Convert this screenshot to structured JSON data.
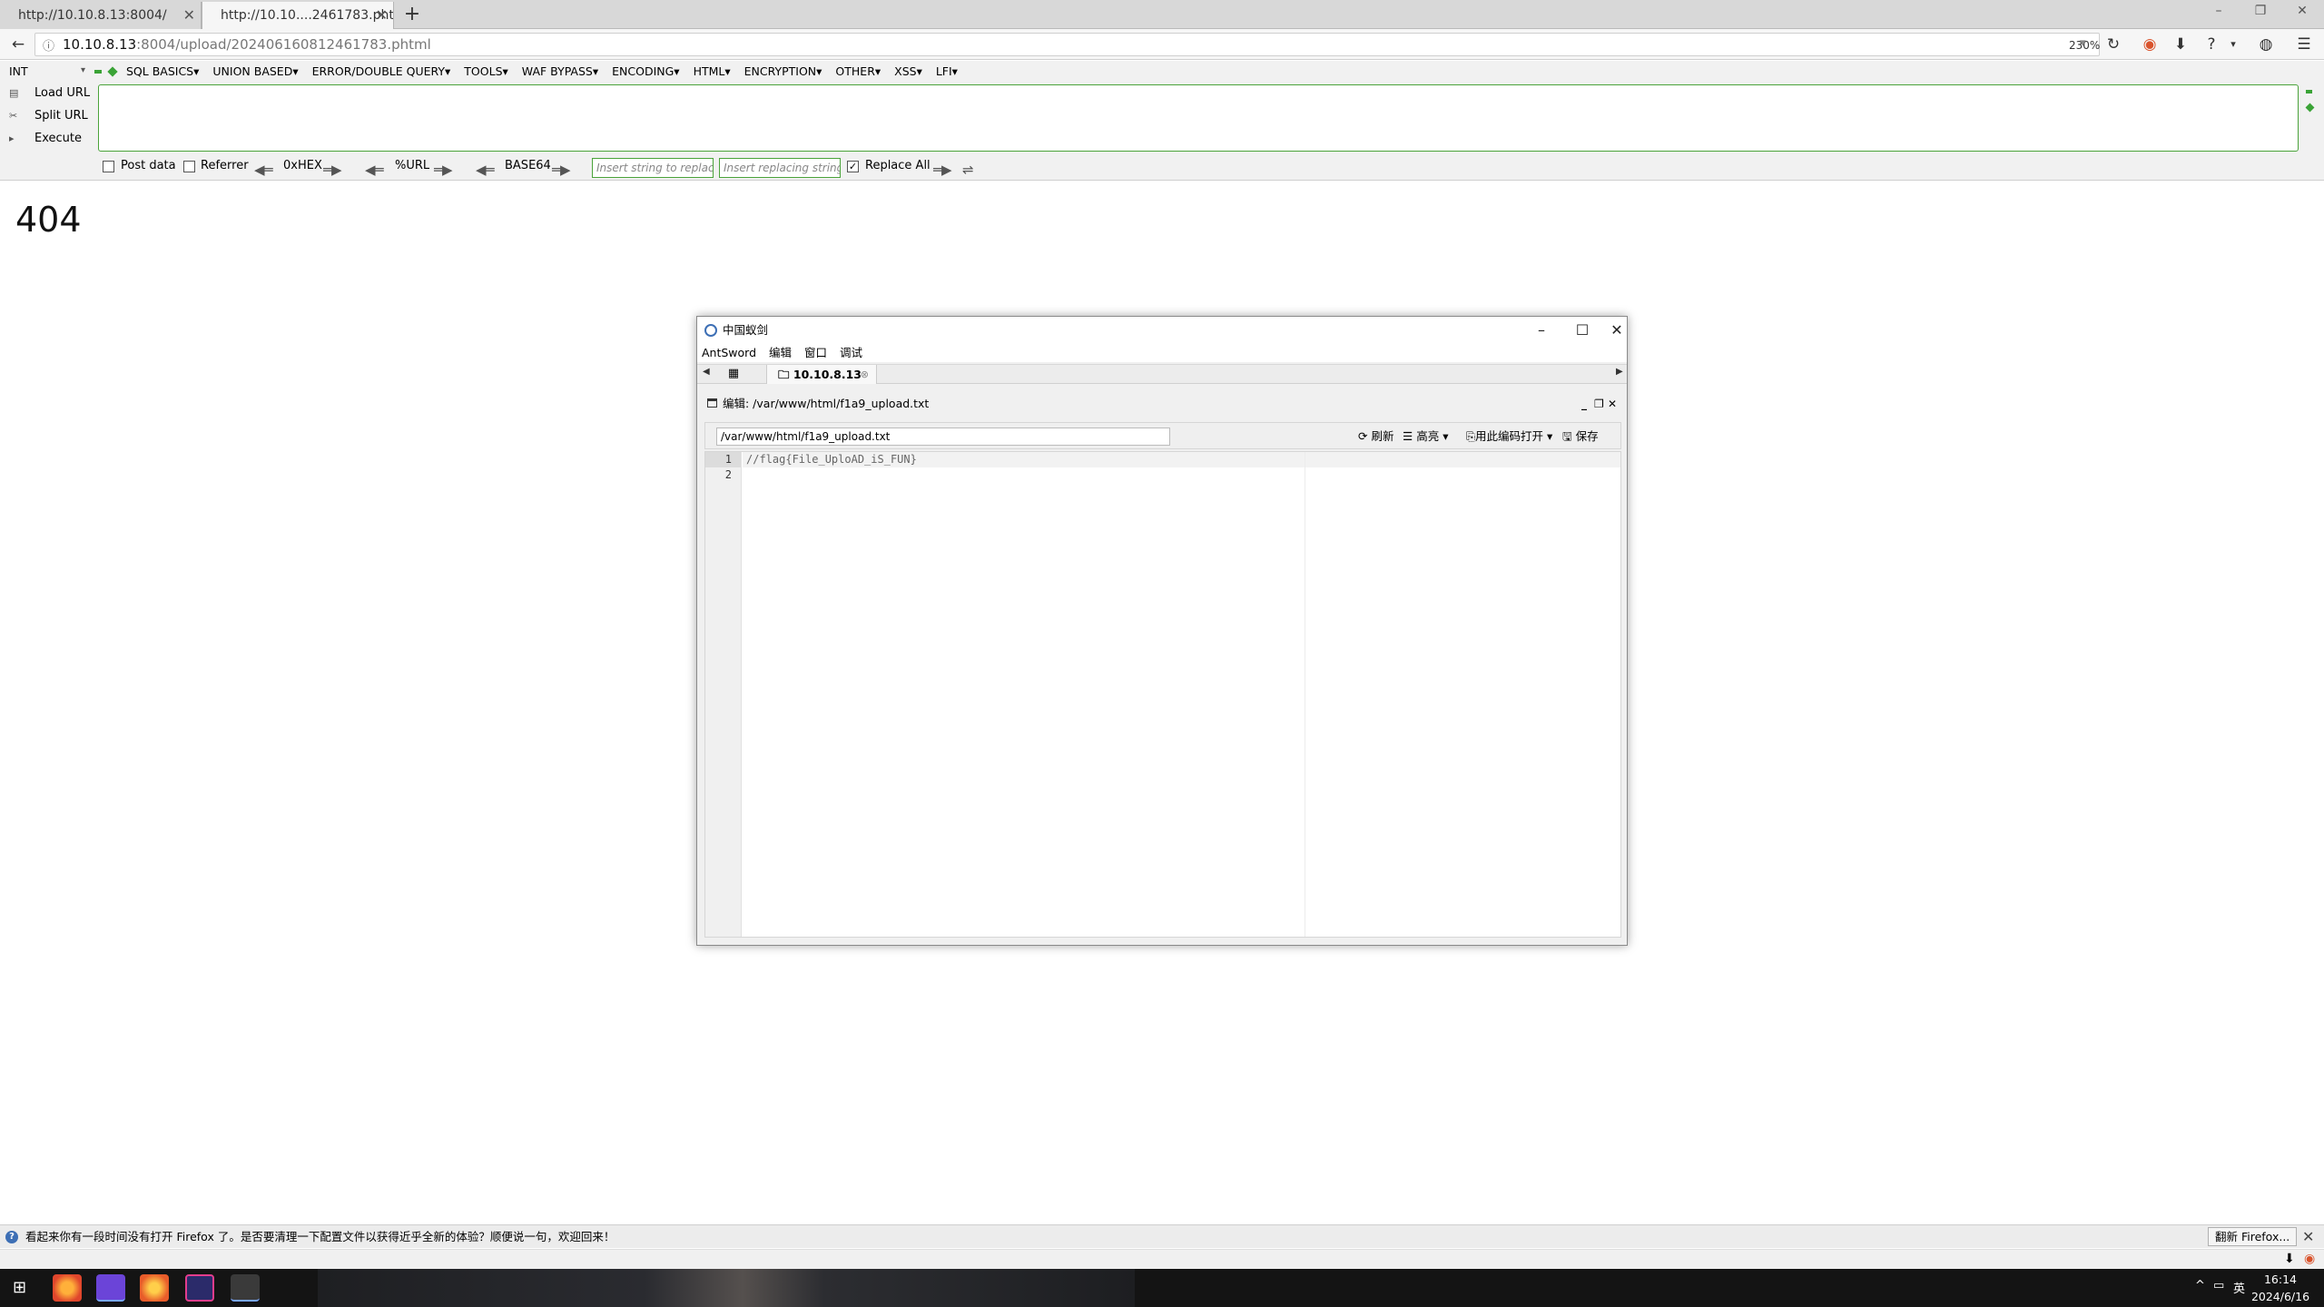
{
  "browser": {
    "tabs": [
      {
        "label": "http://10.10.8.13:8004/"
      },
      {
        "label": "http://10.10....2461783.phtml"
      }
    ],
    "url_host": "10.10.8.13",
    "url_rest": ":8004/upload/20240616081246​1783.phtml",
    "zoom": "230%"
  },
  "hackbar": {
    "select_value": "INT",
    "menu": [
      "SQL BASICS▾",
      "UNION BASED▾",
      "ERROR/DOUBLE QUERY▾",
      "TOOLS▾",
      "WAF BYPASS▾",
      "ENCODING▾",
      "HTML▾",
      "ENCRYPTION▾",
      "OTHER▾",
      "XSS▾",
      "LFI▾"
    ],
    "load_url": "Load URL",
    "split_url": "Split URL",
    "execute": "Execute",
    "post_data": "Post data",
    "referrer": "Referrer",
    "hex": "0xHEX",
    "url_enc": "%URL",
    "base64": "BASE64",
    "insert_placeholder": "Insert string to replace",
    "replacing_placeholder": "Insert replacing string",
    "replace_all": "Replace All"
  },
  "page": {
    "error_text": "404"
  },
  "antsword": {
    "title": "中国蚁剑",
    "menu": [
      "AntSword",
      "编辑",
      "窗口",
      "调试"
    ],
    "tab_label": "10.10.8.13",
    "editor_title": "编辑: /var/www/html/f1a9_upload.txt",
    "path_value": "/var/www/html/f1a9_upload.txt",
    "btn_refresh": "刷新",
    "btn_highlight": "高亮",
    "btn_open_encoding": "用此编码打开",
    "btn_save": "保存",
    "lines": [
      "//flag{File_UploAD_iS_FUN}",
      ""
    ],
    "line_numbers": [
      "1",
      "2"
    ]
  },
  "notification": {
    "message": "看起来你有一段时间没有打开 Firefox 了。是否要清理一下配置文件以获得近乎全新的体验？顺便说一句，欢迎回来！",
    "button": "翻新 Firefox..."
  },
  "taskbar": {
    "lang": "英",
    "time": "16:14",
    "date": "2024/6/16"
  }
}
